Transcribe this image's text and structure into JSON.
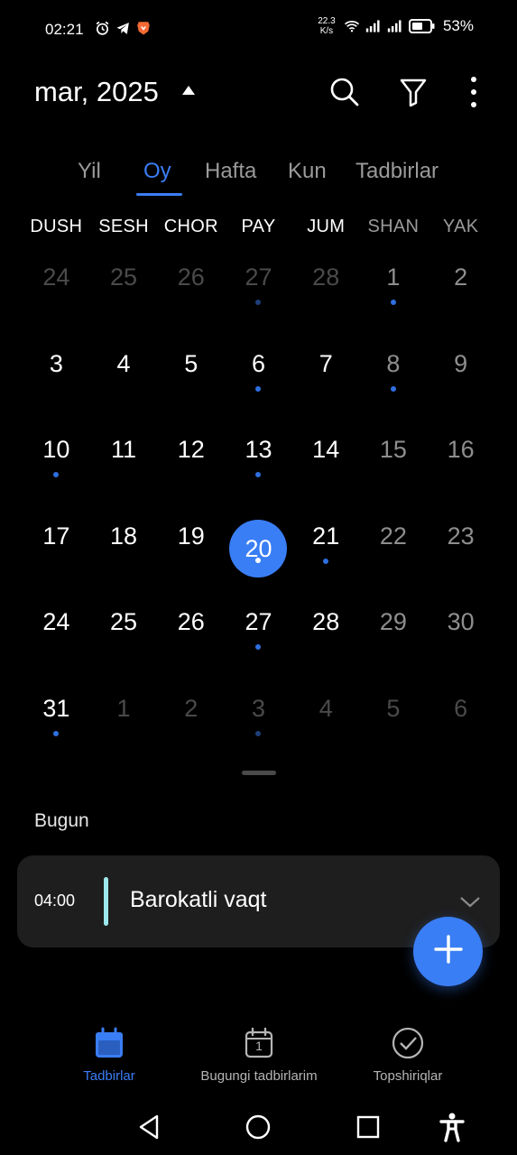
{
  "status_bar": {
    "time": "02:21",
    "net_speed_value": "22.3",
    "net_speed_unit": "K/s",
    "battery": "53%",
    "icons": [
      "alarm-icon",
      "telegram-icon",
      "brave-icon",
      "wifi-icon",
      "signal-icon",
      "signal-icon",
      "battery-icon"
    ]
  },
  "header": {
    "title": "mar, 2025",
    "icons": [
      "caret-up-icon",
      "search-icon",
      "filter-icon",
      "more-vert-icon"
    ]
  },
  "tabs": [
    {
      "label": "Yil",
      "active": false
    },
    {
      "label": "Oy",
      "active": true
    },
    {
      "label": "Hafta",
      "active": false
    },
    {
      "label": "Kun",
      "active": false
    },
    {
      "label": "Tadbirlar",
      "active": false
    }
  ],
  "weekdays": [
    "DUSH",
    "SESH",
    "CHOR",
    "PAY",
    "JUM",
    "SHAN",
    "YAK"
  ],
  "calendar": {
    "days": [
      {
        "n": "24",
        "state": "other",
        "dot": false
      },
      {
        "n": "25",
        "state": "other",
        "dot": false
      },
      {
        "n": "26",
        "state": "other",
        "dot": false
      },
      {
        "n": "27",
        "state": "other",
        "dot": "dim"
      },
      {
        "n": "28",
        "state": "other",
        "dot": false
      },
      {
        "n": "1",
        "state": "weekend",
        "dot": "blue"
      },
      {
        "n": "2",
        "state": "weekend",
        "dot": false
      },
      {
        "n": "3",
        "state": "normal",
        "dot": false
      },
      {
        "n": "4",
        "state": "normal",
        "dot": false
      },
      {
        "n": "5",
        "state": "normal",
        "dot": false
      },
      {
        "n": "6",
        "state": "normal",
        "dot": "blue"
      },
      {
        "n": "7",
        "state": "normal",
        "dot": false
      },
      {
        "n": "8",
        "state": "weekend",
        "dot": "blue"
      },
      {
        "n": "9",
        "state": "weekend",
        "dot": false
      },
      {
        "n": "10",
        "state": "normal",
        "dot": "blue"
      },
      {
        "n": "11",
        "state": "normal",
        "dot": false
      },
      {
        "n": "12",
        "state": "normal",
        "dot": false
      },
      {
        "n": "13",
        "state": "normal",
        "dot": "blue"
      },
      {
        "n": "14",
        "state": "normal",
        "dot": false
      },
      {
        "n": "15",
        "state": "weekend",
        "dot": false
      },
      {
        "n": "16",
        "state": "weekend",
        "dot": false
      },
      {
        "n": "17",
        "state": "normal",
        "dot": false
      },
      {
        "n": "18",
        "state": "normal",
        "dot": false
      },
      {
        "n": "19",
        "state": "normal",
        "dot": false
      },
      {
        "n": "20",
        "state": "today",
        "dot": "white"
      },
      {
        "n": "21",
        "state": "normal",
        "dot": "blue"
      },
      {
        "n": "22",
        "state": "weekend",
        "dot": false
      },
      {
        "n": "23",
        "state": "weekend",
        "dot": false
      },
      {
        "n": "24",
        "state": "normal",
        "dot": false
      },
      {
        "n": "25",
        "state": "normal",
        "dot": false
      },
      {
        "n": "26",
        "state": "normal",
        "dot": false
      },
      {
        "n": "27",
        "state": "normal",
        "dot": "blue"
      },
      {
        "n": "28",
        "state": "normal",
        "dot": false
      },
      {
        "n": "29",
        "state": "weekend",
        "dot": false
      },
      {
        "n": "30",
        "state": "weekend",
        "dot": false
      },
      {
        "n": "31",
        "state": "normal",
        "dot": "blue"
      },
      {
        "n": "1",
        "state": "other",
        "dot": false
      },
      {
        "n": "2",
        "state": "other",
        "dot": false
      },
      {
        "n": "3",
        "state": "other",
        "dot": "dim"
      },
      {
        "n": "4",
        "state": "other",
        "dot": false
      },
      {
        "n": "5",
        "state": "other",
        "dot": false
      },
      {
        "n": "6",
        "state": "other",
        "dot": false
      }
    ]
  },
  "today_section": {
    "label": "Bugun",
    "event": {
      "time": "04:00",
      "title": "Barokatli vaqt",
      "color": "#9de8ec"
    }
  },
  "fab": {
    "icon": "plus-icon"
  },
  "bottom_nav": [
    {
      "label": "Tadbirlar",
      "icon": "calendar-icon",
      "active": true
    },
    {
      "label": "Bugungi tadbirlarim",
      "icon": "calendar-today-icon",
      "day": "1",
      "active": false
    },
    {
      "label": "Topshiriqlar",
      "icon": "check-circle-icon",
      "active": false
    }
  ],
  "system_nav": [
    "back-icon",
    "home-icon",
    "recents-icon",
    "accessibility-icon"
  ],
  "colors": {
    "accent": "#3a7ef5",
    "background": "#000000",
    "card": "#1e1e1e",
    "event_bar": "#9de8ec"
  }
}
